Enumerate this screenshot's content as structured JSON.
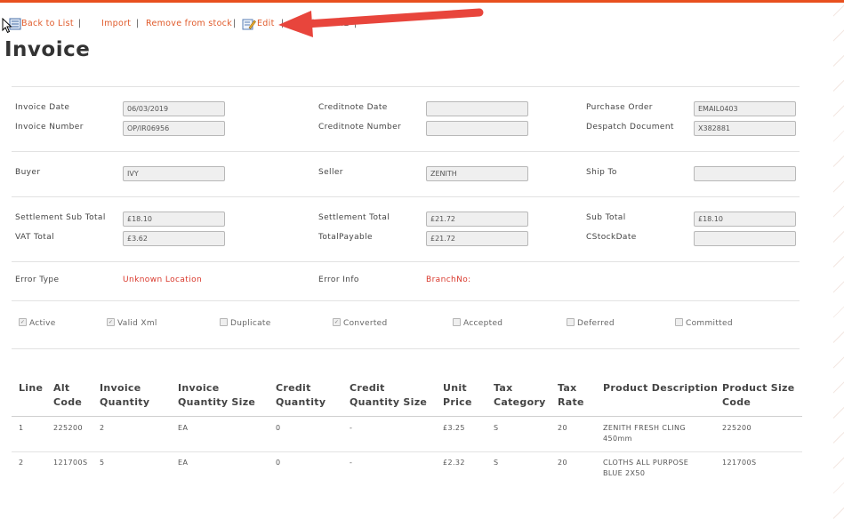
{
  "toolbar": {
    "back": "Back to List",
    "import": "Import",
    "remove": "Remove from stock",
    "edit": "Edit",
    "view_xml": "View XML",
    "separator": "|"
  },
  "page_title": "Invoice",
  "fields": {
    "invoice_date": {
      "label": "Invoice Date",
      "value": "06/03/2019"
    },
    "invoice_number": {
      "label": "Invoice Number",
      "value": "OP/IR06956"
    },
    "creditnote_date": {
      "label": "Creditnote Date",
      "value": ""
    },
    "creditnote_number": {
      "label": "Creditnote Number",
      "value": ""
    },
    "purchase_order": {
      "label": "Purchase Order",
      "value": "EMAIL0403"
    },
    "despatch_document": {
      "label": "Despatch Document",
      "value": "X382881"
    },
    "buyer": {
      "label": "Buyer",
      "value": "IVY"
    },
    "seller": {
      "label": "Seller",
      "value": "ZENITH"
    },
    "ship_to": {
      "label": "Ship To",
      "value": ""
    },
    "settlement_sub_total": {
      "label": "Settlement Sub Total",
      "value": "£18.10"
    },
    "vat_total": {
      "label": "VAT Total",
      "value": "£3.62"
    },
    "settlement_total": {
      "label": "Settlement Total",
      "value": "£21.72"
    },
    "total_payable": {
      "label": "TotalPayable",
      "value": "£21.72"
    },
    "sub_total": {
      "label": "Sub Total",
      "value": "£18.10"
    },
    "cstock_date": {
      "label": "CStockDate",
      "value": ""
    },
    "error_type": {
      "label": "Error Type",
      "value": "Unknown Location"
    },
    "error_info": {
      "label": "Error Info",
      "value": "BranchNo:"
    }
  },
  "checkboxes": [
    {
      "label": "Active",
      "checked": true
    },
    {
      "label": "Valid Xml",
      "checked": true
    },
    {
      "label": "Duplicate",
      "checked": false
    },
    {
      "label": "Converted",
      "checked": true
    },
    {
      "label": "Accepted",
      "checked": false
    },
    {
      "label": "Deferred",
      "checked": false
    },
    {
      "label": "Committed",
      "checked": false
    }
  ],
  "table": {
    "headers": {
      "line": "Line",
      "alt_code_1": "Alt",
      "alt_code_2": "Code",
      "inv_qty_1": "Invoice",
      "inv_qty_2": "Quantity",
      "inv_qty_size_1": "Invoice",
      "inv_qty_size_2": "Quantity Size",
      "credit_qty_1": "Credit",
      "credit_qty_2": "Quantity",
      "credit_qty_size_1": "Credit",
      "credit_qty_size_2": "Quantity Size",
      "unit_price_1": "Unit",
      "unit_price_2": "Price",
      "tax_cat_1": "Tax",
      "tax_cat_2": "Category",
      "tax_rate_1": "Tax",
      "tax_rate_2": "Rate",
      "prod_desc": "Product Description",
      "prod_size_1": "Product Size",
      "prod_size_2": "Code"
    },
    "rows": [
      {
        "line": "1",
        "alt_code": "225200",
        "inv_qty": "2",
        "inv_qty_size": "EA",
        "credit_qty": "0",
        "credit_qty_size": "-",
        "unit_price": "£3.25",
        "tax_cat": "S",
        "tax_rate": "20",
        "desc_1": "ZENITH FRESH CLING",
        "desc_2": "450mm",
        "size_code": "225200"
      },
      {
        "line": "2",
        "alt_code": "121700S",
        "inv_qty": "5",
        "inv_qty_size": "EA",
        "credit_qty": "0",
        "credit_qty_size": "-",
        "unit_price": "£2.32",
        "tax_cat": "S",
        "tax_rate": "20",
        "desc_1": "CLOTHS ALL PURPOSE",
        "desc_2": "BLUE 2X50",
        "size_code": "121700S"
      }
    ]
  },
  "colors": {
    "accent": "#e8501e",
    "link": "#e05a2a",
    "error": "#d9382c",
    "arrow": "#e8453c"
  }
}
